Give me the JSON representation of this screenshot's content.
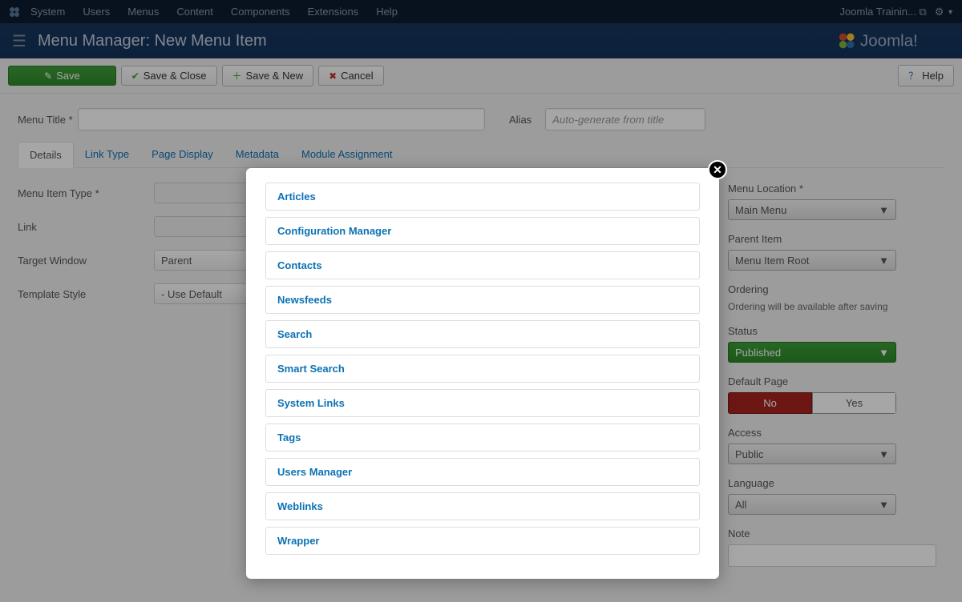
{
  "topnav": {
    "items": [
      "System",
      "Users",
      "Menus",
      "Content",
      "Components",
      "Extensions",
      "Help"
    ],
    "site_name": "Joomla Trainin...",
    "gear": "gear"
  },
  "header": {
    "title": "Menu Manager: New Menu Item"
  },
  "toolbar": {
    "save": "Save",
    "save_close": "Save & Close",
    "save_new": "Save & New",
    "cancel": "Cancel",
    "help": "Help"
  },
  "mainfields": {
    "menu_title_label": "Menu Title",
    "menu_title_value": "",
    "alias_label": "Alias",
    "alias_placeholder": "Auto-generate from title"
  },
  "tabs": [
    "Details",
    "Link Type",
    "Page Display",
    "Metadata",
    "Module Assignment"
  ],
  "active_tab": 0,
  "left_form": {
    "menu_item_type_label": "Menu Item Type *",
    "link_label": "Link",
    "target_window_label": "Target Window",
    "target_window_value": "Parent",
    "template_style_label": "Template Style",
    "template_style_value": "- Use Default"
  },
  "right_form": {
    "menu_location_label": "Menu Location *",
    "menu_location_value": "Main Menu",
    "parent_item_label": "Parent Item",
    "parent_item_value": "Menu Item Root",
    "ordering_label": "Ordering",
    "ordering_text": "Ordering will be available after saving",
    "status_label": "Status",
    "status_value": "Published",
    "default_page_label": "Default Page",
    "default_page_no": "No",
    "default_page_yes": "Yes",
    "access_label": "Access",
    "access_value": "Public",
    "language_label": "Language",
    "language_value": "All",
    "note_label": "Note"
  },
  "modal": {
    "items": [
      "Articles",
      "Configuration Manager",
      "Contacts",
      "Newsfeeds",
      "Search",
      "Smart Search",
      "System Links",
      "Tags",
      "Users Manager",
      "Weblinks",
      "Wrapper"
    ]
  }
}
